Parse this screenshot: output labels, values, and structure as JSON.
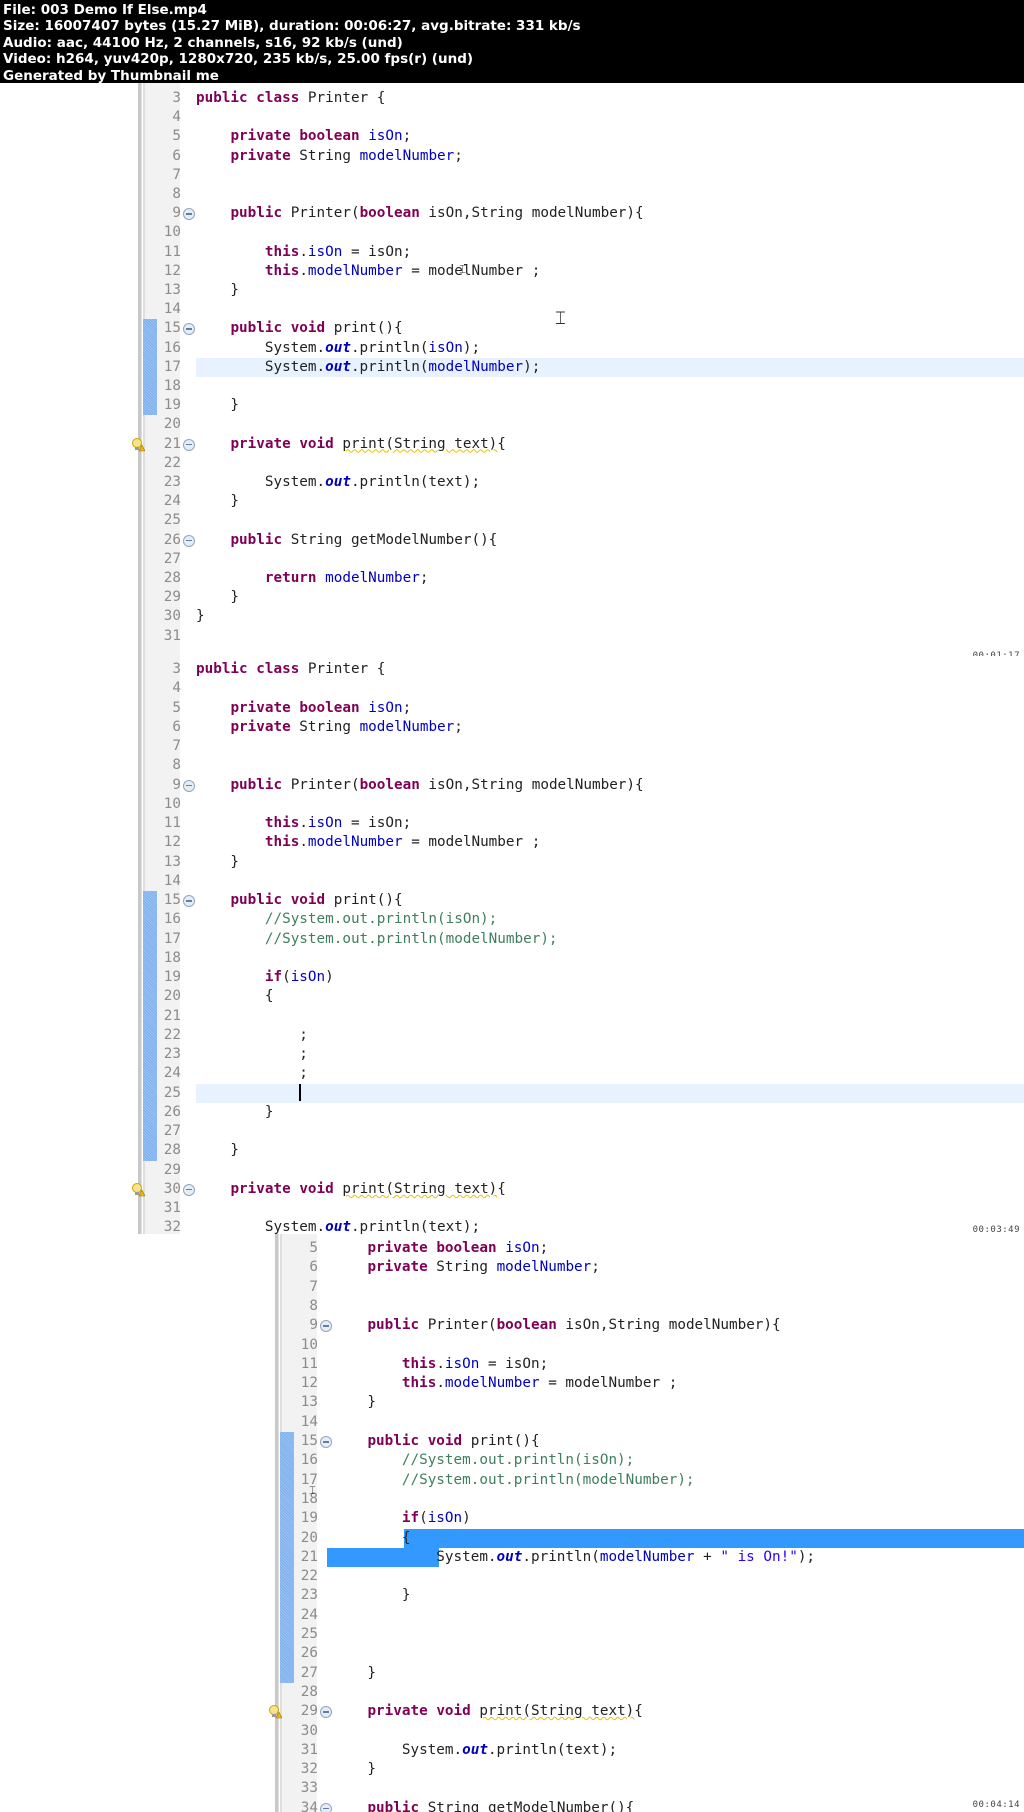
{
  "header": {
    "file_line": "File: 003 Demo If  Else.mp4",
    "size_line": "Size: 16007407 bytes (15.27 MiB), duration: 00:06:27, avg.bitrate: 331 kb/s",
    "audio_line": "Audio: aac, 44100 Hz, 2 channels, s16, 92 kb/s (und)",
    "video_line": "Video: h264, yuv420p, 1280x720, 235 kb/s, 25.00 fps(r) (und)",
    "generator_line": "Generated by Thumbnail me"
  },
  "frames": [
    {
      "timestamp": "00:01:17",
      "lines": [
        {
          "n": "3",
          "html": "<span class='kw'>public</span> <span class='kw'>class</span> Printer {"
        },
        {
          "n": "4",
          "html": ""
        },
        {
          "n": "5",
          "html": "    <span class='kw'>private</span> <span class='kw'>boolean</span> <span class='fld'>isOn</span>;"
        },
        {
          "n": "6",
          "html": "    <span class='kw'>private</span> String <span class='fld'>modelNumber</span>;"
        },
        {
          "n": "7",
          "html": ""
        },
        {
          "n": "8",
          "html": ""
        },
        {
          "n": "9",
          "fold": true,
          "html": "    <span class='kw'>public</span> Printer(<span class='kw'>boolean</span> isOn,String modelNumber){"
        },
        {
          "n": "10",
          "html": ""
        },
        {
          "n": "11",
          "html": "        <span class='kw'>this</span>.<span class='fld'>isOn</span> = isOn;"
        },
        {
          "n": "12",
          "html": "        <span class='kw'>this</span>.<span class='fld'>modelNumber</span> = modelNumber ;"
        },
        {
          "n": "13",
          "html": "    }"
        },
        {
          "n": "14",
          "html": ""
        },
        {
          "n": "15",
          "fold": true,
          "mark": true,
          "html": "    <span class='kw'>public</span> <span class='kw'>void</span> print(){"
        },
        {
          "n": "16",
          "mark": true,
          "html": "        System.<span class='stat'>out</span>.println(<span class='fld'>isOn</span>);"
        },
        {
          "n": "17",
          "mark": true,
          "current": true,
          "html": "        System.<span class='stat'>out</span>.println(<span class='fld'>modelNumber</span>);"
        },
        {
          "n": "18",
          "mark": true,
          "html": ""
        },
        {
          "n": "19",
          "mark": true,
          "html": "    }"
        },
        {
          "n": "20",
          "html": ""
        },
        {
          "n": "21",
          "fold": true,
          "warn": true,
          "html": "    <span class='kw'>private</span> <span class='kw'>void</span> <span class='warnline'>print(String text)</span>{"
        },
        {
          "n": "22",
          "html": ""
        },
        {
          "n": "23",
          "html": "        System.<span class='stat'>out</span>.println(text);"
        },
        {
          "n": "24",
          "html": "    }"
        },
        {
          "n": "25",
          "html": ""
        },
        {
          "n": "26",
          "fold": true,
          "html": "    <span class='kw'>public</span> String getModelNumber(){"
        },
        {
          "n": "27",
          "html": ""
        },
        {
          "n": "28",
          "html": "        <span class='kw'>return</span> <span class='fld'>modelNumber</span>;"
        },
        {
          "n": "29",
          "html": "    }"
        },
        {
          "n": "30",
          "html": "}"
        },
        {
          "n": "31",
          "html": ""
        }
      ]
    },
    {
      "timestamp": "00:03:49",
      "lines": [
        {
          "n": "3",
          "html": "<span class='kw'>public</span> <span class='kw'>class</span> Printer {"
        },
        {
          "n": "4",
          "html": ""
        },
        {
          "n": "5",
          "html": "    <span class='kw'>private</span> <span class='kw'>boolean</span> <span class='fld'>isOn</span>;"
        },
        {
          "n": "6",
          "html": "    <span class='kw'>private</span> String <span class='fld'>modelNumber</span>;"
        },
        {
          "n": "7",
          "html": ""
        },
        {
          "n": "8",
          "html": ""
        },
        {
          "n": "9",
          "fold": true,
          "html": "    <span class='kw'>public</span> Printer(<span class='kw'>boolean</span> isOn,String modelNumber){"
        },
        {
          "n": "10",
          "html": ""
        },
        {
          "n": "11",
          "html": "        <span class='kw'>this</span>.<span class='fld'>isOn</span> = isOn;"
        },
        {
          "n": "12",
          "html": "        <span class='kw'>this</span>.<span class='fld'>modelNumber</span> = modelNumber ;"
        },
        {
          "n": "13",
          "html": "    }"
        },
        {
          "n": "14",
          "html": ""
        },
        {
          "n": "15",
          "fold": true,
          "mark": true,
          "html": "    <span class='kw'>public</span> <span class='kw'>void</span> print(){"
        },
        {
          "n": "16",
          "mark": true,
          "html": "        <span class='cmt'>//System.out.println(isOn);</span>"
        },
        {
          "n": "17",
          "mark": true,
          "html": "        <span class='cmt'>//System.out.println(modelNumber);</span>"
        },
        {
          "n": "18",
          "mark": true,
          "html": ""
        },
        {
          "n": "19",
          "mark": true,
          "html": "        <span class='kw'>if</span>(<span class='fld'>isOn</span>)"
        },
        {
          "n": "20",
          "mark": true,
          "html": "        {"
        },
        {
          "n": "21",
          "mark": true,
          "html": ""
        },
        {
          "n": "22",
          "mark": true,
          "html": "            ;"
        },
        {
          "n": "23",
          "mark": true,
          "html": "            ;"
        },
        {
          "n": "24",
          "mark": true,
          "html": "            ;"
        },
        {
          "n": "25",
          "mark": true,
          "current": true,
          "html": "            <span class='caret'></span>"
        },
        {
          "n": "26",
          "mark": true,
          "html": "        }"
        },
        {
          "n": "27",
          "mark": true,
          "html": ""
        },
        {
          "n": "28",
          "mark": true,
          "html": "    }"
        },
        {
          "n": "29",
          "html": ""
        },
        {
          "n": "30",
          "fold": true,
          "warn": true,
          "html": "    <span class='kw'>private</span> <span class='kw'>void</span> <span class='warnline'>print(String text)</span>{"
        },
        {
          "n": "31",
          "html": ""
        },
        {
          "n": "32",
          "html": "        System.<span class='stat'>out</span>.println(text);"
        }
      ]
    },
    {
      "timestamp": "00:04:14",
      "lines": [
        {
          "n": "5",
          "html": "    <span class='kw'>private</span> <span class='kw'>boolean</span> <span class='fld'>isOn</span>;"
        },
        {
          "n": "6",
          "html": "    <span class='kw'>private</span> String <span class='fld'>modelNumber</span>;"
        },
        {
          "n": "7",
          "html": ""
        },
        {
          "n": "8",
          "html": ""
        },
        {
          "n": "9",
          "fold": true,
          "html": "    <span class='kw'>public</span> Printer(<span class='kw'>boolean</span> isOn,String modelNumber){"
        },
        {
          "n": "10",
          "html": ""
        },
        {
          "n": "11",
          "html": "        <span class='kw'>this</span>.<span class='fld'>isOn</span> = isOn;"
        },
        {
          "n": "12",
          "html": "        <span class='kw'>this</span>.<span class='fld'>modelNumber</span> = modelNumber ;"
        },
        {
          "n": "13",
          "html": "    }"
        },
        {
          "n": "14",
          "html": ""
        },
        {
          "n": "15",
          "fold": true,
          "mark": true,
          "html": "    <span class='kw'>public</span> <span class='kw'>void</span> print(){"
        },
        {
          "n": "16",
          "mark": true,
          "html": "        <span class='cmt'>//System.out.println(isOn);</span>"
        },
        {
          "n": "17",
          "mark": true,
          "html": "        <span class='cmt'>//System.out.println(modelNumber);</span>"
        },
        {
          "n": "18",
          "mark": true,
          "html": ""
        },
        {
          "n": "19",
          "mark": true,
          "html": "        <span class='kw'>if</span>(<span class='fld'>isOn</span>)"
        },
        {
          "n": "20",
          "mark": true,
          "selFrom": 8,
          "html": "        {"
        },
        {
          "n": "21",
          "mark": true,
          "selTo": 12,
          "html": "            System.<span class='stat'>out</span>.println(<span class='fld'>modelNumber</span> + <span class='str'>\" is On!\"</span>);"
        },
        {
          "n": "22",
          "mark": true,
          "html": ""
        },
        {
          "n": "23",
          "mark": true,
          "html": "        }"
        },
        {
          "n": "24",
          "mark": true,
          "html": ""
        },
        {
          "n": "25",
          "mark": true,
          "html": ""
        },
        {
          "n": "26",
          "mark": true,
          "html": ""
        },
        {
          "n": "27",
          "mark": true,
          "html": "    }"
        },
        {
          "n": "28",
          "html": ""
        },
        {
          "n": "29",
          "fold": true,
          "warn": true,
          "html": "    <span class='kw'>private</span> <span class='kw'>void</span> <span class='warnline'>print(String text)</span>{"
        },
        {
          "n": "30",
          "html": ""
        },
        {
          "n": "31",
          "html": "        System.<span class='stat'>out</span>.println(text);"
        },
        {
          "n": "32",
          "html": "    }"
        },
        {
          "n": "33",
          "html": ""
        },
        {
          "n": "34",
          "fold": true,
          "html": "    <span class='kw'>public</span> String getModelNumber(){"
        }
      ]
    }
  ]
}
